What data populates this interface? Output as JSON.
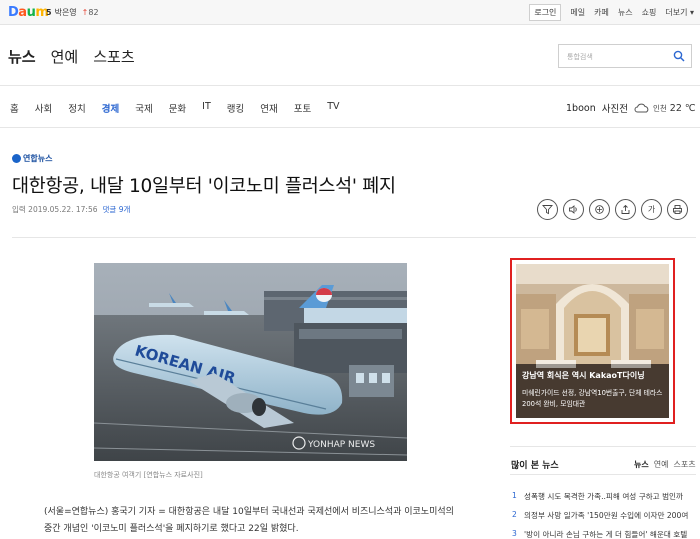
{
  "topbar": {
    "logo": {
      "d": "D",
      "a": "a",
      "u": "u",
      "m": "m"
    },
    "rank": {
      "num": "5",
      "name": "박은영",
      "arrow": "↑",
      "value": "82"
    },
    "login": "로그인",
    "links": [
      "메일",
      "카페",
      "뉴스",
      "쇼핑",
      "더보기 ▾"
    ]
  },
  "header": {
    "sections": [
      "뉴스",
      "연예",
      "스포츠"
    ],
    "search_placeholder": "통합검색"
  },
  "nav": {
    "items": [
      "홈",
      "사회",
      "정치",
      "경제",
      "국제",
      "문화",
      "IT",
      "랭킹",
      "연재",
      "포토",
      "TV"
    ],
    "active": "경제",
    "right": [
      "1boon",
      "사진전"
    ],
    "weather": {
      "city": "인천",
      "temp": "22 ℃"
    }
  },
  "article": {
    "press": "연합뉴스",
    "title": "대한항공, 내달 10일부터 '이코노미 플러스석' 폐지",
    "date": "입력 2019.05.22. 17:56",
    "comments": "댓글 9개",
    "tools": [
      "filter",
      "speaker",
      "share-up",
      "share",
      "가",
      "print"
    ],
    "photo_caption": "대한항공 여객기 [연합뉴스 자료사진]",
    "photo_text": {
      "airline": "KOREAN AIR",
      "watermark": "YONHAP NEWS"
    },
    "body": "(서울=연합뉴스) 홍국기 기자 = 대한항공은 내달 10일부터 국내선과 국제선에서 비즈니스석과 이코노미석의 중간 개념인 '이코노미 플러스석'을 폐지하기로 했다고 22일 밝혔다."
  },
  "ad": {
    "title": "강남역 회식은 역시 KakaoT다이닝",
    "desc": "미쉐린가이드 선정, 강남역10번출구, 단체 테라스 200석 완비, 모임대관"
  },
  "popular": {
    "title": "많이 본 뉴스",
    "tabs": [
      "뉴스",
      "연예",
      "스포츠"
    ],
    "items": [
      {
        "n": "1",
        "t": "성폭행 시도 목격한 가족..피해 여성 구하고 범인까"
      },
      {
        "n": "2",
        "t": "의정부 사망 일가족 '150만원 수입에 이자만 200여"
      },
      {
        "n": "3",
        "t": "'방이 아니라 손님 구하는 게 더 힘들어' 해운대 호텔"
      }
    ]
  },
  "colors": {
    "accent": "#2c67d1",
    "ad_border": "#e02020",
    "press": "#1a4fa0"
  }
}
